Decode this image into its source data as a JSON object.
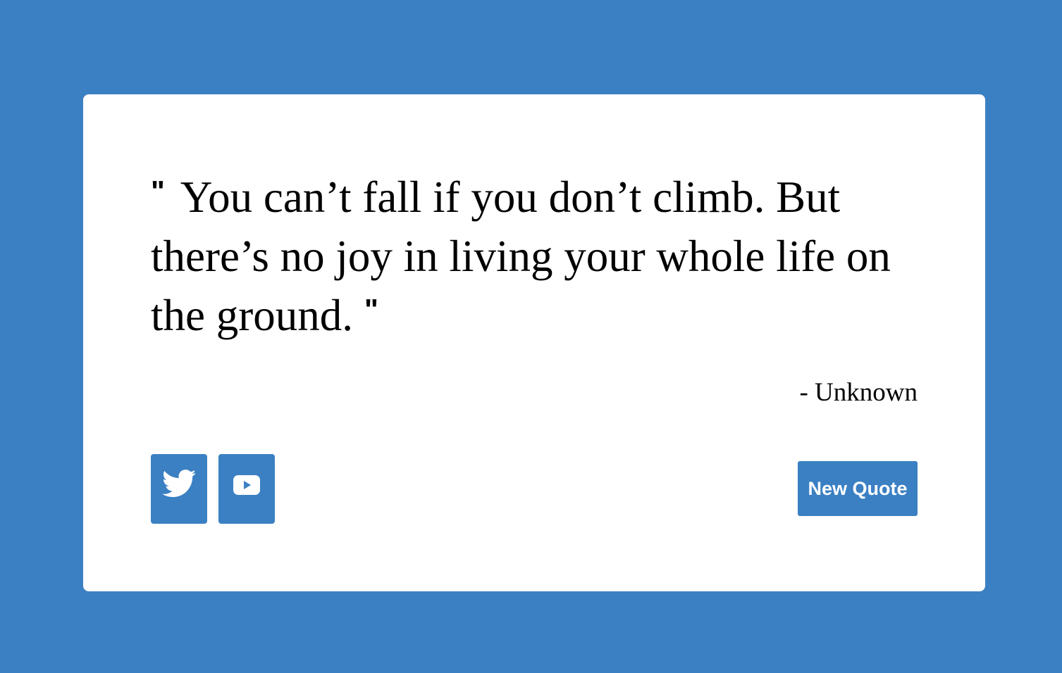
{
  "quote": {
    "open_mark": "\"",
    "text": "You can’t fall if you don’t climb. But there’s no joy in living your whole life on the ground.",
    "close_mark": "\"",
    "author": "- Unknown"
  },
  "actions": {
    "twitter_icon": "twitter-icon",
    "youtube_icon": "youtube-icon",
    "new_quote_label": "New Quote"
  },
  "colors": {
    "background": "#3b80c3",
    "card": "#ffffff",
    "button": "#3b80c3",
    "button_text": "#ffffff",
    "text": "#000000"
  }
}
